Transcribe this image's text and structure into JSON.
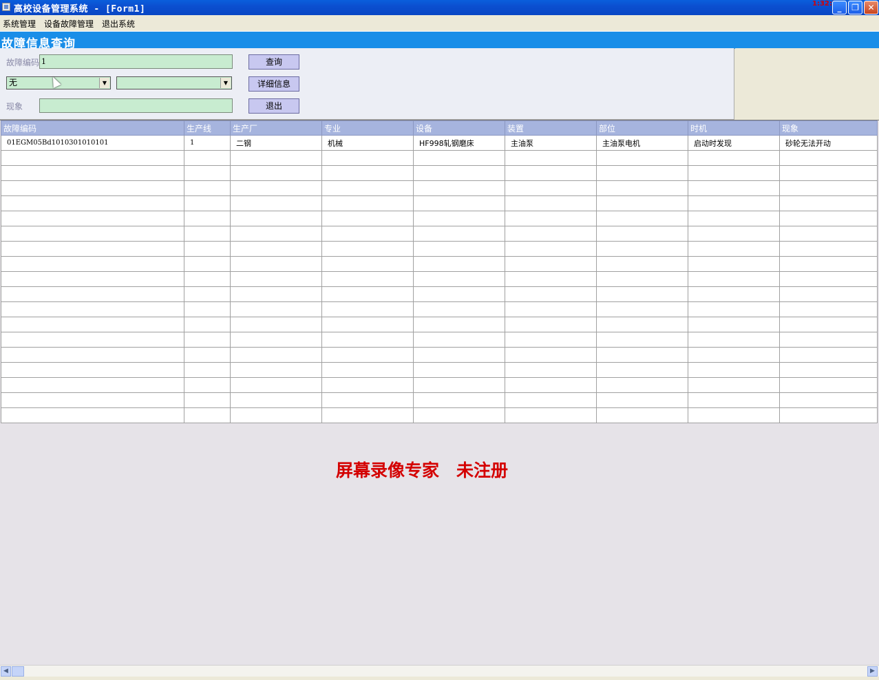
{
  "window": {
    "title": "高校设备管理系统 - [Form1]",
    "corner_text": "1:32:20",
    "controls": {
      "minimize": "_",
      "maximize": "❐",
      "close": "✕"
    }
  },
  "menu": [
    "系统管理",
    "设备故障管理",
    "退出系统"
  ],
  "form": {
    "heading": "故障信息查询",
    "code_label": "故障编码",
    "code_value": "1",
    "combo1_value": "无",
    "combo2_value": "",
    "phenomenon_label": "现象",
    "phenomenon_value": "",
    "buttons": {
      "query": "查询",
      "detail": "详细信息",
      "exit": "退出"
    }
  },
  "grid": {
    "columns": [
      "故障编码",
      "生产线",
      "生产厂",
      "专业",
      "设备",
      "装置",
      "部位",
      "时机",
      "现象"
    ],
    "rows": [
      [
        "01EGM05Bd1010301010101",
        "1",
        "二钢",
        "机械",
        "HF998轧钢磨床",
        "主油泵",
        "主油泵电机",
        "启动时发现",
        "砂轮无法开动"
      ]
    ]
  },
  "watermark": "屏幕录像专家　未注册",
  "colors": {
    "accent": "#1a8ee8",
    "input_bg": "#c8ecd0",
    "header_bg": "#a6b4de",
    "watermark": "#d40000"
  }
}
